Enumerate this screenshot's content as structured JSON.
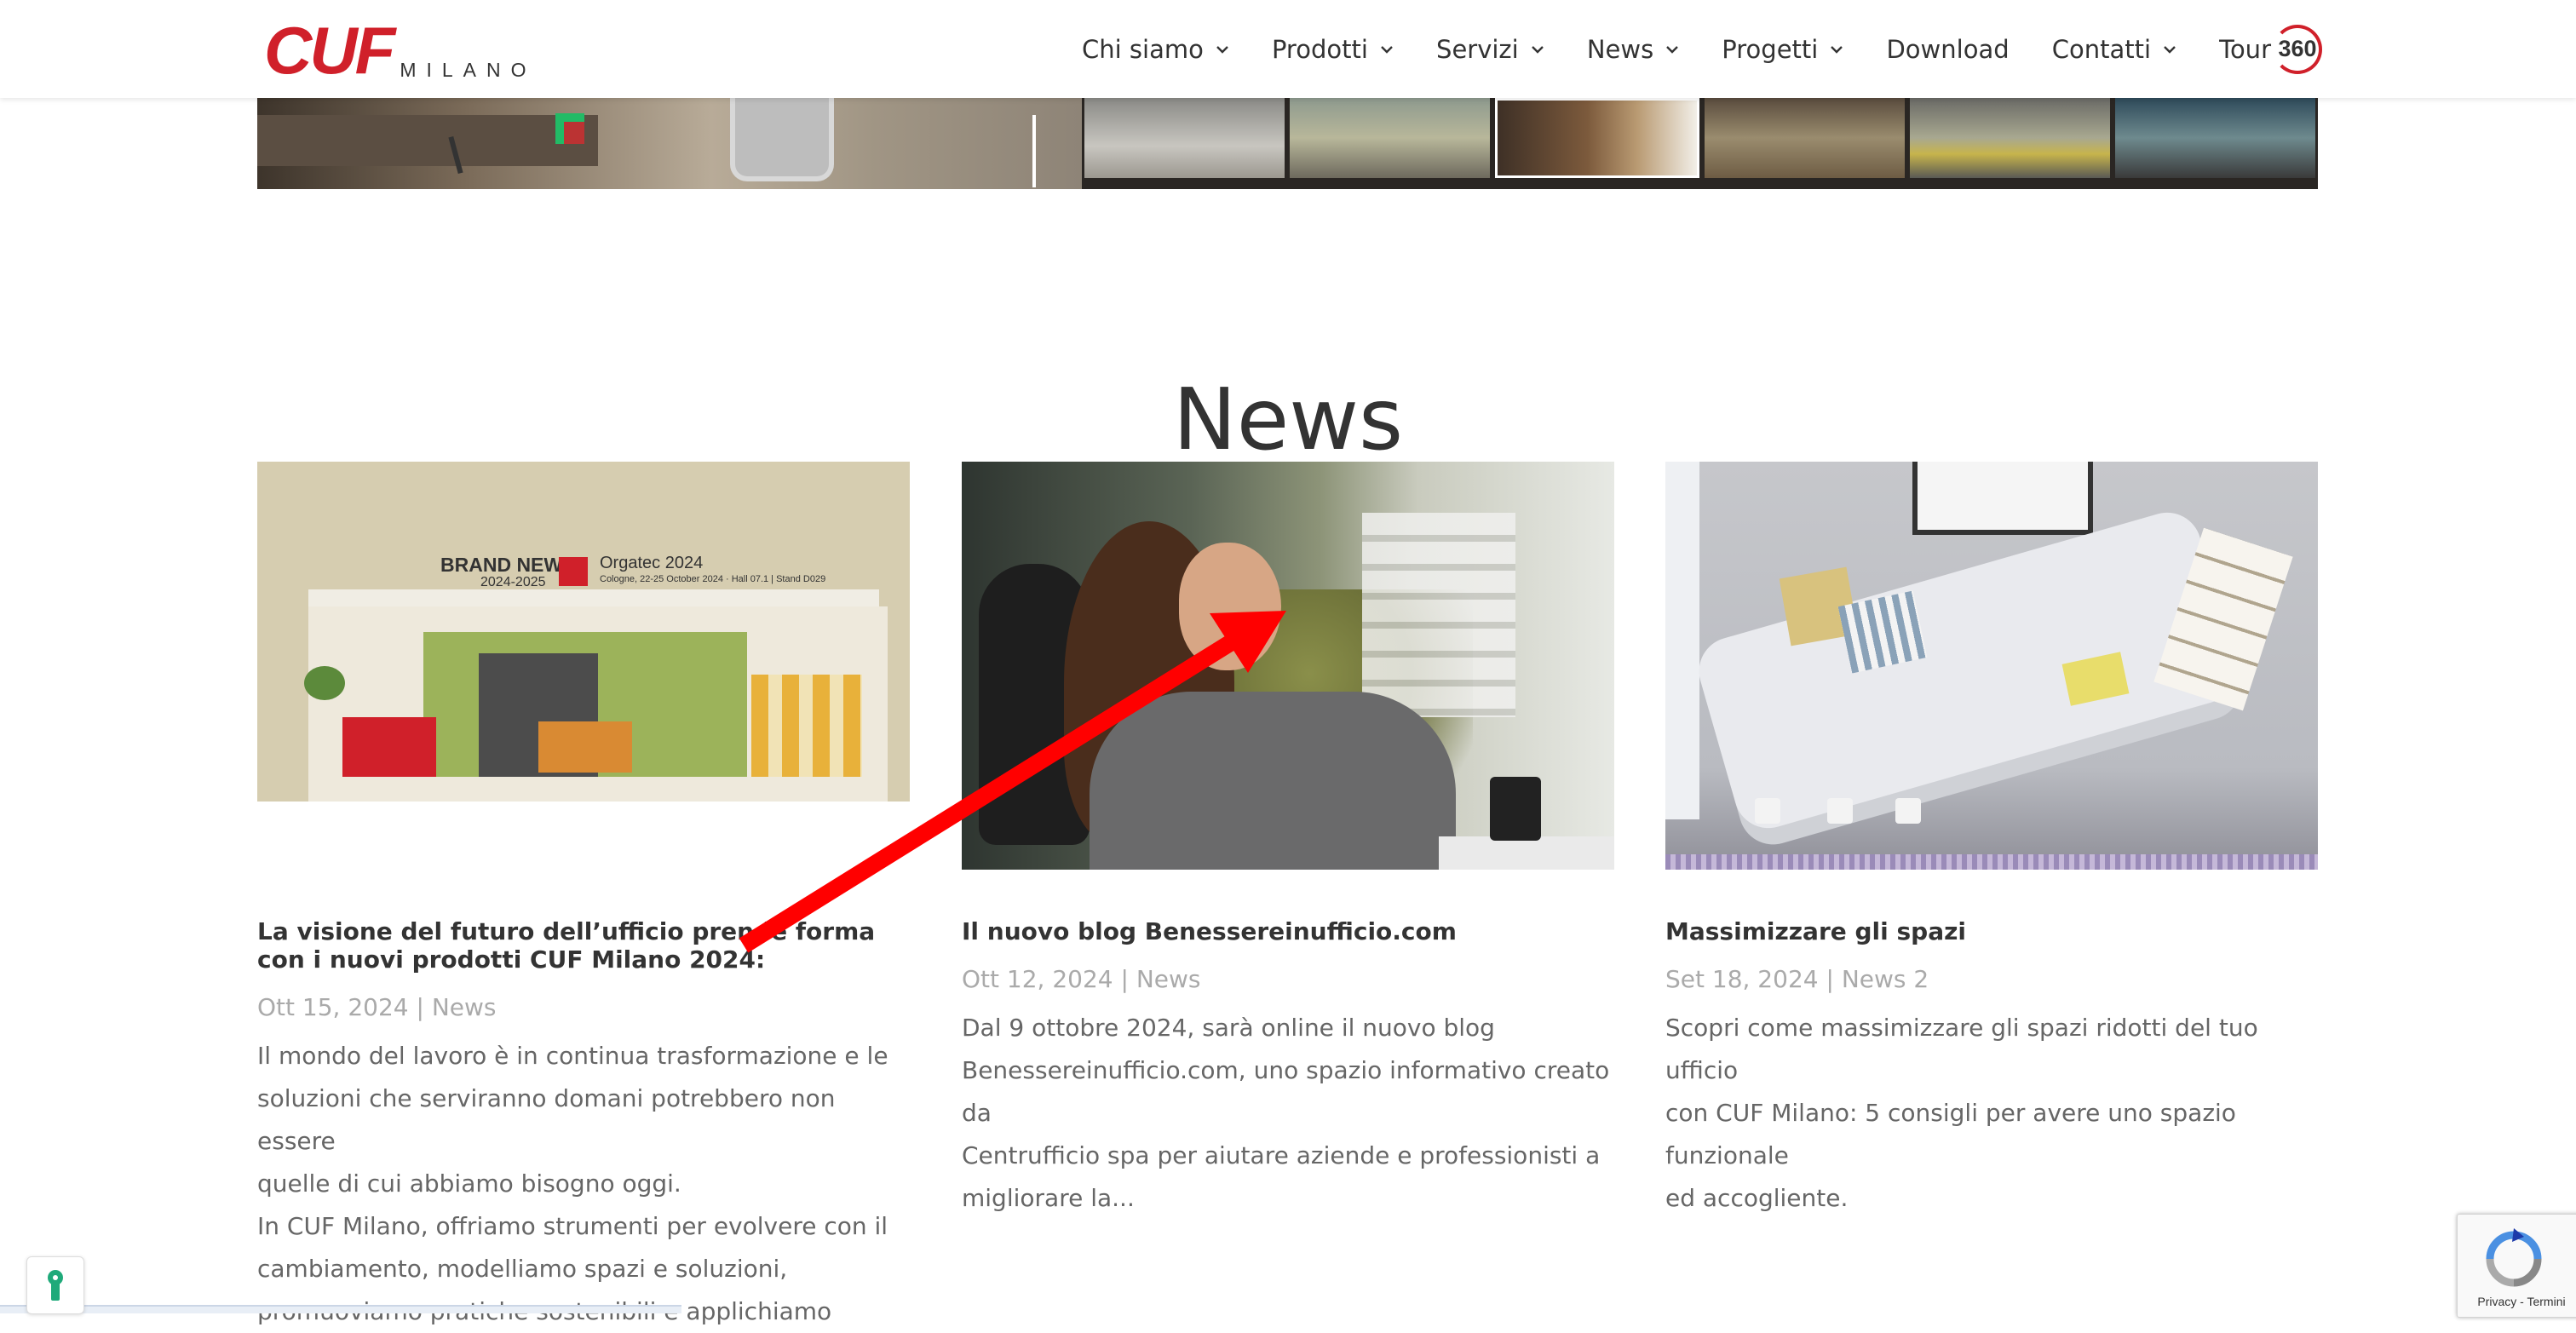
{
  "header": {
    "logo_main": "CUF",
    "logo_sub": "MILANO",
    "nav": [
      {
        "label": "Chi siamo",
        "has_dropdown": true
      },
      {
        "label": "Prodotti",
        "has_dropdown": true
      },
      {
        "label": "Servizi",
        "has_dropdown": true
      },
      {
        "label": "News",
        "has_dropdown": true
      },
      {
        "label": "Progetti",
        "has_dropdown": true
      },
      {
        "label": "Download",
        "has_dropdown": false
      },
      {
        "label": "Contatti",
        "has_dropdown": true
      }
    ],
    "tour_label": "Tour",
    "tour_badge": "360"
  },
  "section": {
    "title": "News"
  },
  "cards": [
    {
      "title": "La visione del futuro dell’ufficio prende forma con i nuovi prodotti CUF Milano 2024:",
      "date": "Ott 15, 2024",
      "separator": "|",
      "category": "News",
      "excerpt_lines": [
        "Il mondo del lavoro è in continua trasformazione e le",
        "soluzioni che serviranno domani potrebbero non essere",
        "quelle di cui abbiamo bisogno oggi.",
        "In CUF Milano, offriamo strumenti per evolvere con il",
        "cambiamento, modelliamo spazi e soluzioni,",
        "promuoviamo pratiche sostenibili e applichiamo"
      ],
      "image_text": {
        "brand_new": "BRAND NEW",
        "years": "2024-2025",
        "event": "Orgatec 2024",
        "event_details": "Cologne, 22-25 October 2024 · Hall 07.1 | Stand D029"
      }
    },
    {
      "title": "Il nuovo blog Benessereinufficio.com",
      "date": "Ott 12, 2024",
      "separator": "|",
      "category": "News",
      "excerpt_lines": [
        "Dal 9 ottobre 2024, sarà online il nuovo blog",
        "Benessereinufficio.com, uno spazio informativo creato da",
        "Centrufficio spa per aiutare aziende e professionisti a",
        "migliorare la..."
      ]
    },
    {
      "title": "Massimizzare gli spazi",
      "date": "Set 18, 2024",
      "separator": "|",
      "category": "News 2",
      "excerpt_lines": [
        "Scopri come massimizzare gli spazi ridotti del tuo ufficio",
        "con CUF Milano: 5 consigli per avere uno spazio funzionale",
        "ed accogliente."
      ]
    }
  ],
  "recaptcha": {
    "links": "Privacy - Termini"
  },
  "colors": {
    "brand_red": "#d0202a",
    "text_dark": "#333333",
    "text_meta": "#aaaaaa",
    "text_body": "#666666",
    "annotation_arrow": "#ff0000"
  },
  "icons": {
    "nav_dropdown": "chevron-down-icon",
    "cookie": "keyhole-icon",
    "recaptcha": "recaptcha-icon"
  }
}
